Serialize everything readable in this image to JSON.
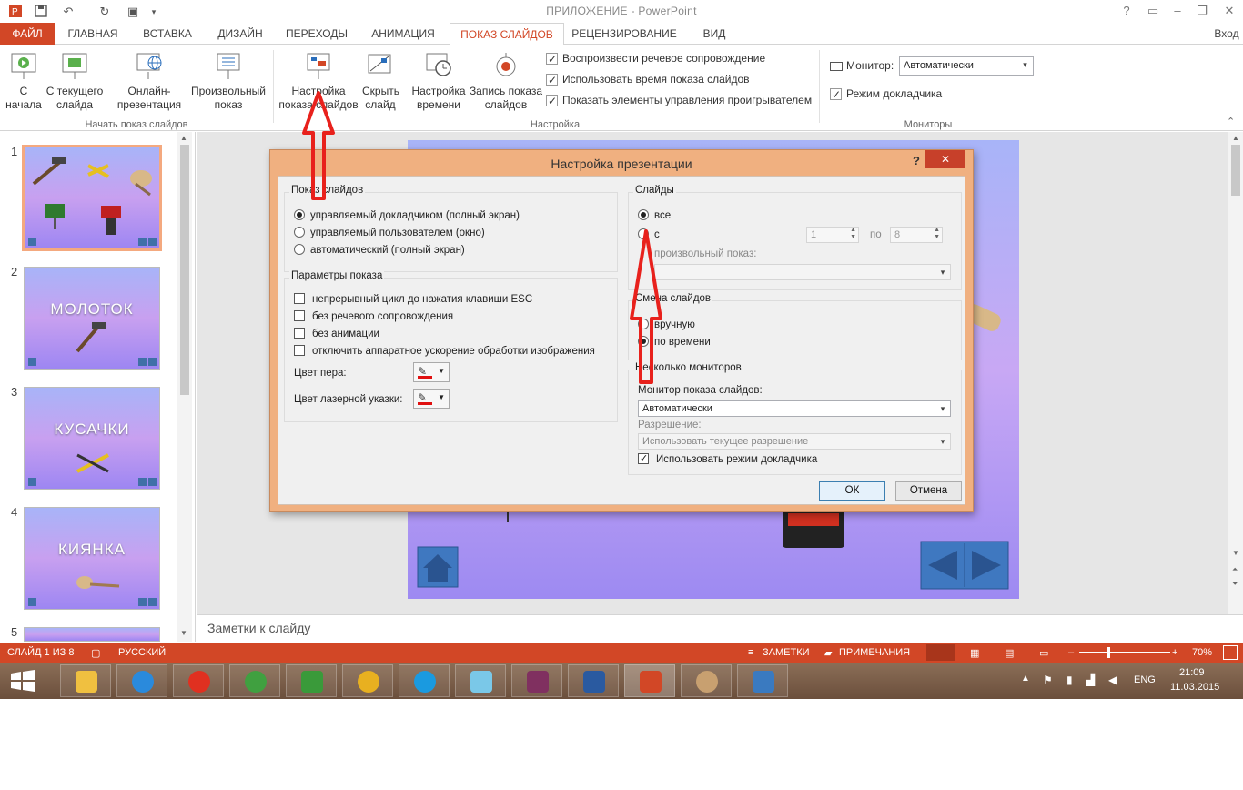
{
  "window": {
    "title": "ПРИЛОЖЕНИЕ - PowerPoint",
    "help": "?",
    "signin": "Вход"
  },
  "tabs": [
    {
      "label": "ФАЙЛ"
    },
    {
      "label": "ГЛАВНАЯ"
    },
    {
      "label": "ВСТАВКА"
    },
    {
      "label": "ДИЗАЙН"
    },
    {
      "label": "ПЕРЕХОДЫ"
    },
    {
      "label": "АНИМАЦИЯ"
    },
    {
      "label": "ПОКАЗ СЛАЙДОВ"
    },
    {
      "label": "РЕЦЕНЗИРОВАНИЕ"
    },
    {
      "label": "ВИД"
    }
  ],
  "ribbon": {
    "start": {
      "from_begin": "С начала",
      "from_current": "С текущего слайда",
      "online": "Онлайн-презентация",
      "custom": "Произвольный показ",
      "group": "Начать показ слайдов"
    },
    "setup": {
      "setup_show": "Настройка показа слайдов",
      "hide_slide": "Скрыть слайд",
      "rehearse": "Настройка времени",
      "record": "Запись показа слайдов",
      "play_narrations": "Воспроизвести речевое сопровождение",
      "use_timings": "Использовать время показа слайдов",
      "show_media": "Показать элементы управления проигрывателем",
      "group": "Настройка"
    },
    "monitors": {
      "monitor_label": "Монитор:",
      "monitor_value": "Автоматически",
      "presenter_view": "Режим докладчика",
      "group": "Мониторы"
    }
  },
  "thumbnails": [
    {
      "num": "1",
      "title": ""
    },
    {
      "num": "2",
      "title": "МОЛОТОК"
    },
    {
      "num": "3",
      "title": "КУСАЧКИ"
    },
    {
      "num": "4",
      "title": "КИЯНКА"
    },
    {
      "num": "5",
      "title": ""
    }
  ],
  "notes": "Заметки к слайду",
  "status": {
    "slide": "СЛАЙД 1 ИЗ 8",
    "lang": "РУССКИЙ",
    "notes": "ЗАМЕТКИ",
    "comments": "ПРИМЕЧАНИЯ",
    "zoom": "70%"
  },
  "taskbar": {
    "lang": "ENG",
    "time": "21:09",
    "date": "11.03.2015"
  },
  "dialog": {
    "title": "Настройка презентации",
    "help": "?",
    "close": "✕",
    "show_type": {
      "title": "Показ слайдов",
      "opt1": "управляемый докладчиком (полный экран)",
      "opt2": "управляемый пользователем (окно)",
      "opt3": "автоматический (полный экран)"
    },
    "options": {
      "title": "Параметры показа",
      "loop": "непрерывный цикл до нажатия клавиши ESC",
      "no_narration": "без речевого сопровождения",
      "no_animation": "без анимации",
      "no_hw": "отключить аппаратное ускорение обработки изображения",
      "pen_color": "Цвет пера:",
      "laser_color": "Цвет лазерной указки:"
    },
    "slides": {
      "title": "Слайды",
      "all": "все",
      "from": "с",
      "from_value": "1",
      "to": "по",
      "to_value": "8",
      "custom": "произвольный показ:"
    },
    "advance": {
      "title": "Смена слайдов",
      "manual": "вручную",
      "timings": "по времени"
    },
    "multi": {
      "title": "Несколько мониторов",
      "monitor_label": "Монитор показа слайдов:",
      "monitor_value": "Автоматически",
      "resolution_label": "Разрешение:",
      "resolution_value": "Использовать текущее разрешение",
      "presenter": "Использовать режим докладчика"
    },
    "ok": "ОК",
    "cancel": "Отмена"
  },
  "colors": {
    "accent": "#d24726",
    "arrow": "#e8211c",
    "slide_gradient": "#a8b4f8"
  }
}
